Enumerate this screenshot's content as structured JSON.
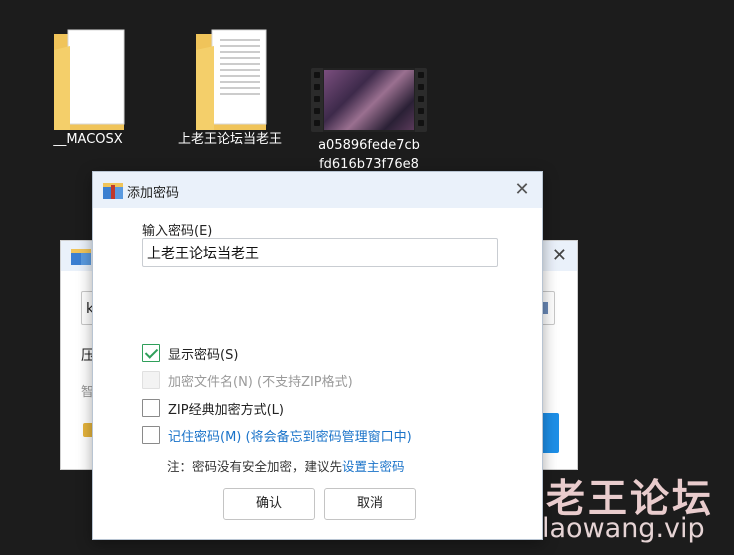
{
  "desktop": {
    "icons": [
      {
        "label": "__MACOSX"
      },
      {
        "label": "上老王论坛当老王"
      },
      {
        "label_line1": "a05896fede7cb",
        "label_line2": "fd616b73f76e8"
      }
    ]
  },
  "background_window": {
    "input_value": "k",
    "line1": "压",
    "line2": "智"
  },
  "dialog": {
    "title": "添加密码",
    "password_label": "输入密码(E)",
    "password_value": "上老王论坛当老王",
    "options": {
      "show_password": {
        "label": "显示密码(S)",
        "checked": true
      },
      "encrypt_filenames": {
        "label": "加密文件名(N) (不支持ZIP格式)",
        "disabled": true
      },
      "zip_classic": {
        "label": "ZIP经典加密方式(L)",
        "checked": false
      },
      "remember_password": {
        "label": "记住密码(M) (将会备忘到密码管理窗口中)",
        "checked": false
      }
    },
    "note_prefix": "注：密码没有安全加密，建议先",
    "note_link": "设置主密码",
    "ok_label": "确认",
    "cancel_label": "取消"
  },
  "watermark": {
    "cn": "老王论坛",
    "url": "laowang.vip"
  },
  "colors": {
    "link": "#1a73c9",
    "check": "#2f9f5a",
    "titlebar": "#eaf1fa",
    "desktop_bg": "#1c1c1c"
  }
}
